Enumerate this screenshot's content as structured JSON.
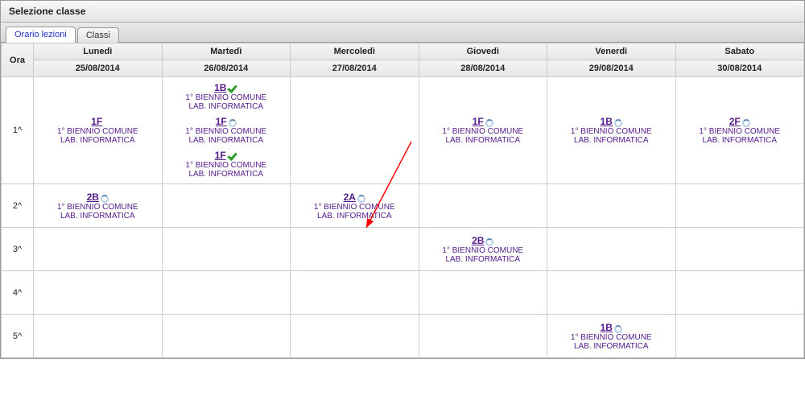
{
  "panel_title": "Selezione classe",
  "tabs": [
    {
      "label": "Orario lezioni",
      "active": true
    },
    {
      "label": "Classi",
      "active": false
    }
  ],
  "header": {
    "ora": "Ora",
    "days": [
      {
        "name": "Lunedì",
        "date": "25/08/2014"
      },
      {
        "name": "Martedì",
        "date": "26/08/2014"
      },
      {
        "name": "Mercoledì",
        "date": "27/08/2014"
      },
      {
        "name": "Giovedì",
        "date": "28/08/2014"
      },
      {
        "name": "Venerdì",
        "date": "29/08/2014"
      },
      {
        "name": "Sabato",
        "date": "30/08/2014"
      }
    ]
  },
  "rows": [
    {
      "ora": "1^",
      "cells": [
        [
          {
            "class": "1F",
            "status": "none",
            "line1": "1° BIENNIO COMUNE",
            "line2": "LAB. INFORMATICA"
          }
        ],
        [
          {
            "class": "1B",
            "status": "check",
            "line1": "1° BIENNIO COMUNE",
            "line2": "LAB. INFORMATICA"
          },
          {
            "class": "1F",
            "status": "pending",
            "line1": "1° BIENNIO COMUNE",
            "line2": "LAB. INFORMATICA"
          },
          {
            "class": "1F",
            "status": "check",
            "line1": "1° BIENNIO COMUNE",
            "line2": "LAB. INFORMATICA"
          }
        ],
        [],
        [
          {
            "class": "1F",
            "status": "pending",
            "line1": "1° BIENNIO COMUNE",
            "line2": "LAB. INFORMATICA"
          }
        ],
        [
          {
            "class": "1B",
            "status": "pending",
            "line1": "1° BIENNIO COMUNE",
            "line2": "LAB. INFORMATICA"
          }
        ],
        [
          {
            "class": "2F",
            "status": "pending",
            "line1": "1° BIENNIO COMUNE",
            "line2": "LAB. INFORMATICA"
          }
        ]
      ]
    },
    {
      "ora": "2^",
      "cells": [
        [
          {
            "class": "2B",
            "status": "pending",
            "line1": "1° BIENNIO COMUNE",
            "line2": "LAB. INFORMATICA"
          }
        ],
        [],
        [
          {
            "class": "2A",
            "status": "pending",
            "line1": "1° BIENNIO COMUNE",
            "line2": "LAB. INFORMATICA"
          }
        ],
        [],
        [],
        []
      ]
    },
    {
      "ora": "3^",
      "cells": [
        [],
        [],
        [],
        [
          {
            "class": "2B",
            "status": "pending",
            "line1": "1° BIENNIO COMUNE",
            "line2": "LAB. INFORMATICA"
          }
        ],
        [],
        []
      ]
    },
    {
      "ora": "4^",
      "cells": [
        [],
        [],
        [],
        [],
        [],
        []
      ]
    },
    {
      "ora": "5^",
      "cells": [
        [],
        [],
        [],
        [],
        [
          {
            "class": "1B",
            "status": "pending",
            "line1": "1° BIENNIO COMUNE",
            "line2": "LAB. INFORMATICA"
          }
        ],
        []
      ]
    }
  ],
  "annotation": {
    "type": "arrow",
    "target": "row2-col3-entry"
  }
}
